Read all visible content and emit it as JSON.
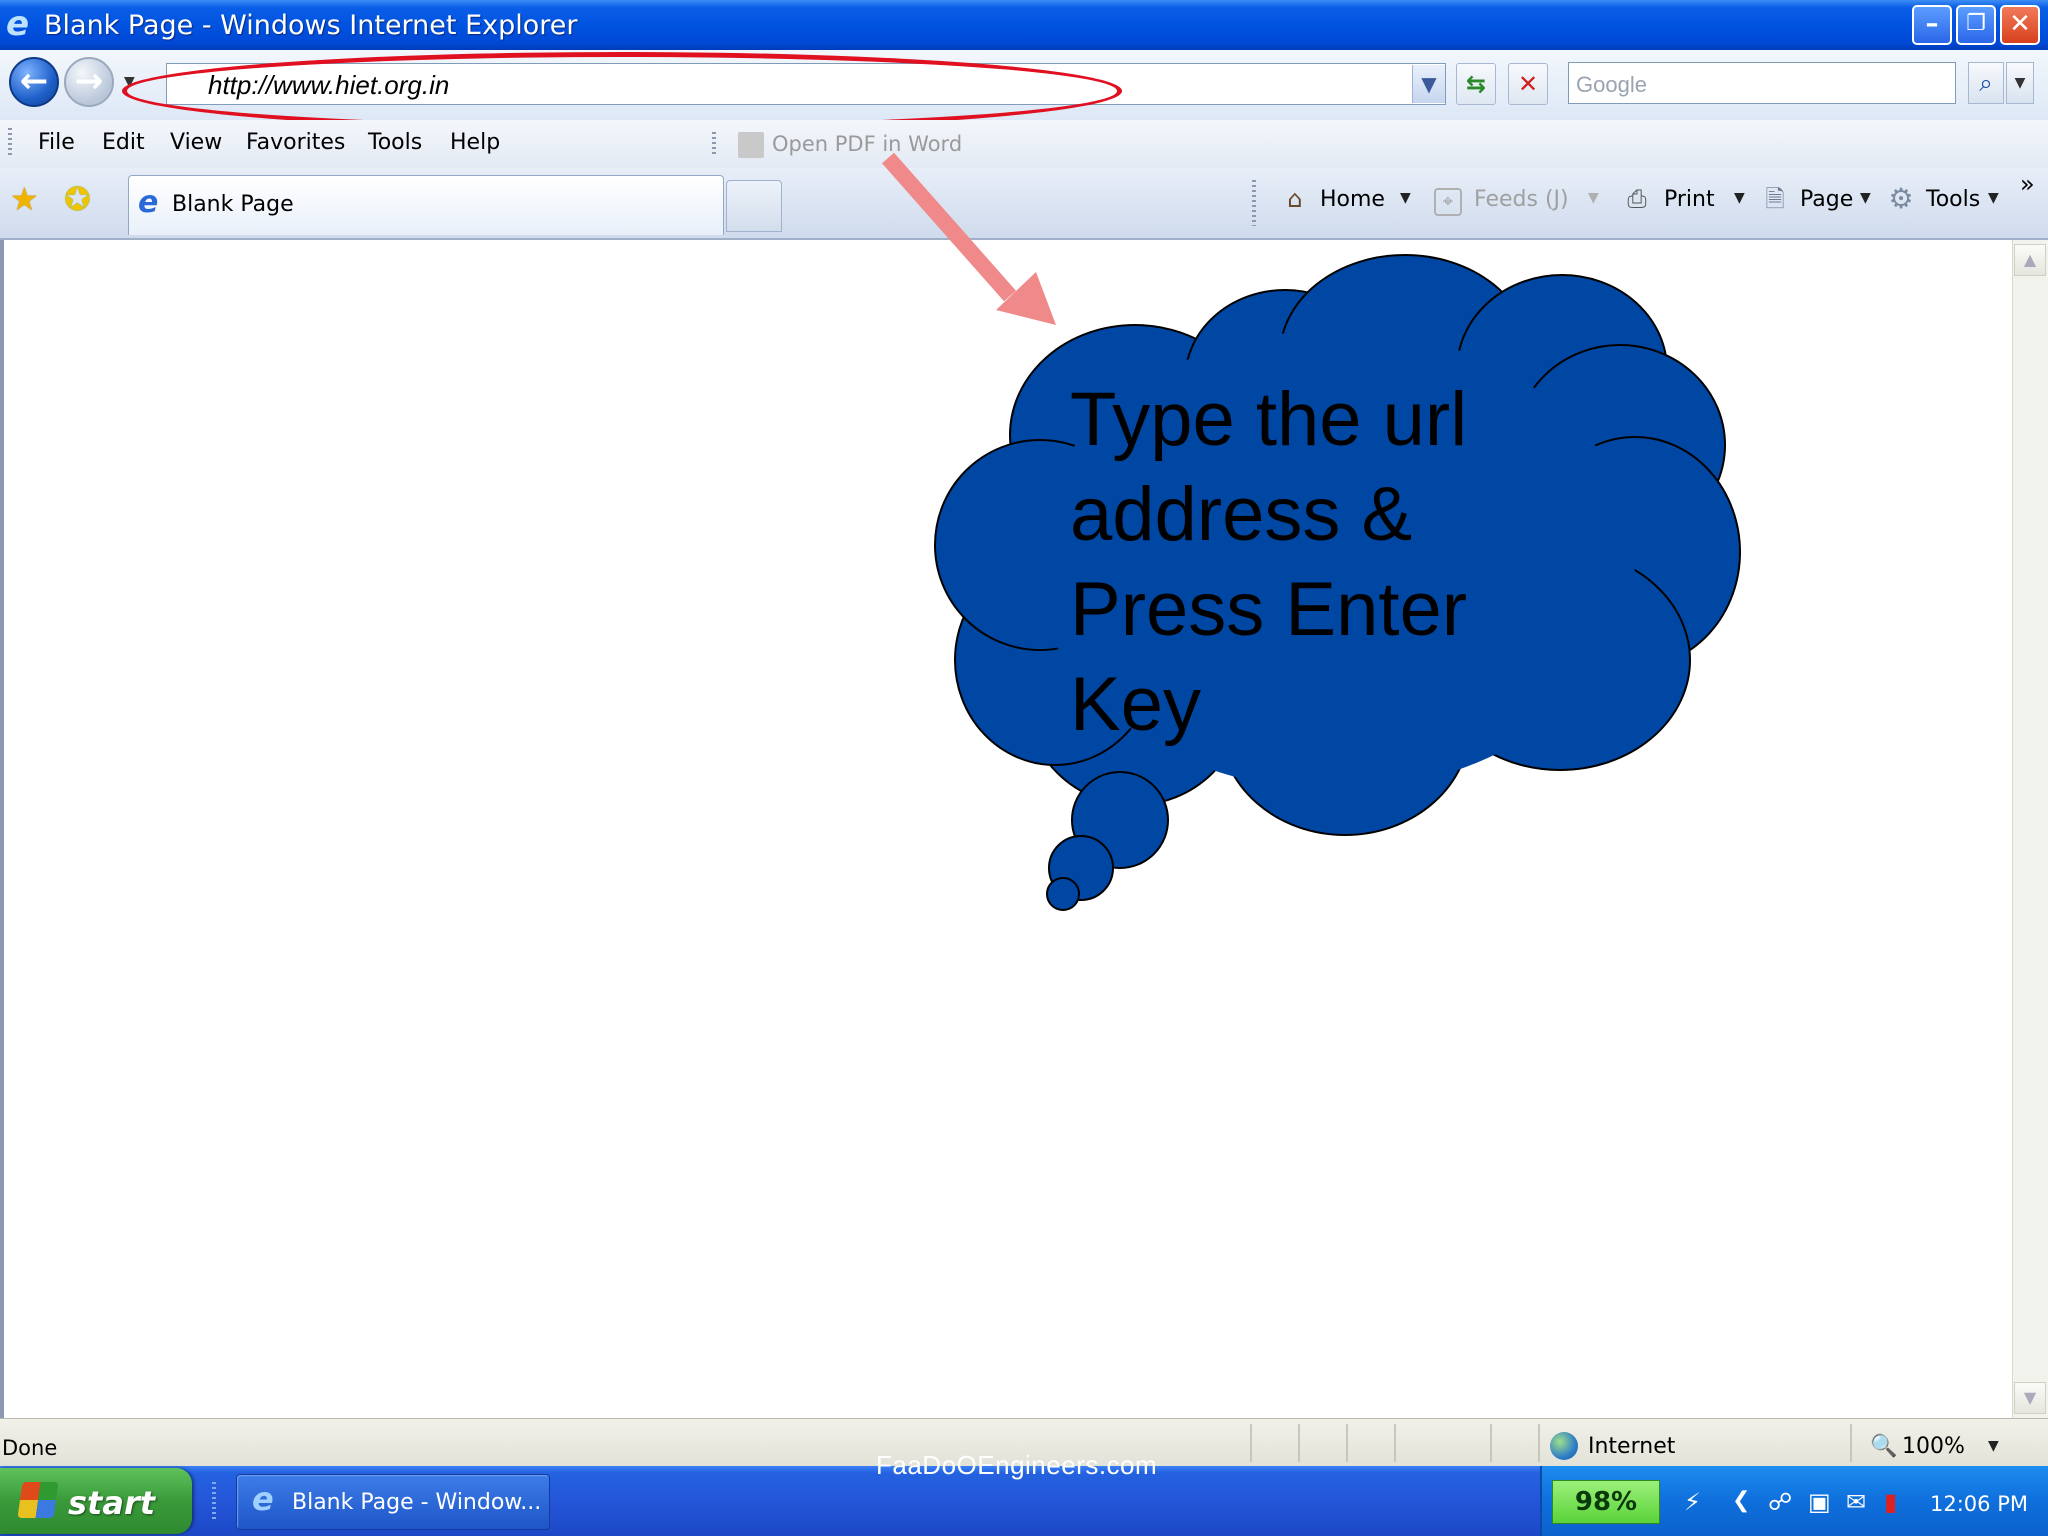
{
  "window": {
    "title": "Blank Page - Windows Internet Explorer",
    "minimize_glyph": "–",
    "restore_glyph": "❐",
    "close_glyph": "✕"
  },
  "toolbar": {
    "address_value": "http://www.hiet.org.in",
    "search_placeholder": "Google",
    "refresh_glyph": "⇆",
    "stop_glyph": "✕",
    "search_glyph": "⌕"
  },
  "menu": {
    "items": [
      "File",
      "Edit",
      "View",
      "Favorites",
      "Tools",
      "Help"
    ],
    "addon_label": "Open PDF in Word"
  },
  "tabs": {
    "active_label": "Blank Page"
  },
  "commands": {
    "home": "Home",
    "feeds": "Feeds (J)",
    "print": "Print",
    "page": "Page",
    "tools": "Tools",
    "overflow": "»"
  },
  "callout": {
    "lines": [
      "Type the url",
      "address &",
      "Press Enter",
      "Key"
    ],
    "fill_color": "#0047a3",
    "arrow_color": "#f08080"
  },
  "status": {
    "text": "Done",
    "zone": "Internet",
    "zoom": "100%"
  },
  "watermark": "FaaDoOEngineers.com",
  "taskbar": {
    "start_label": "start",
    "task_label": "Blank Page - Window...",
    "battery": "98%",
    "clock": "12:06 PM"
  },
  "icons": {
    "back": "back-arrow-icon",
    "forward": "forward-arrow-icon",
    "favorites": "star-icon",
    "add_favorites": "add-favorite-icon",
    "home": "house-icon",
    "feeds": "rss-icon",
    "print": "printer-icon",
    "page": "page-icon",
    "tools": "gear-icon"
  }
}
